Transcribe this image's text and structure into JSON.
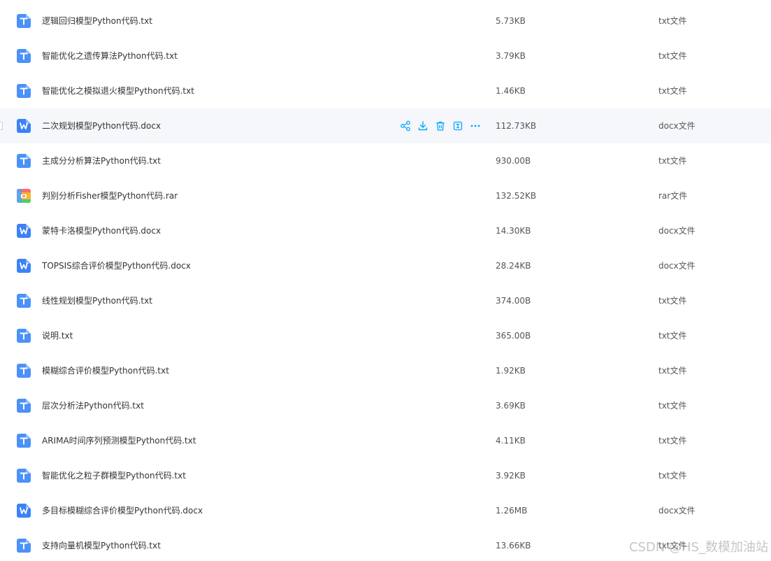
{
  "files": [
    {
      "name": "逻辑回归模型Python代码.txt",
      "size": "5.73KB",
      "type": "txt文件",
      "icon": "txt-file-icon"
    },
    {
      "name": "智能优化之遗传算法Python代码.txt",
      "size": "3.79KB",
      "type": "txt文件",
      "icon": "txt-file-icon"
    },
    {
      "name": "智能优化之模拟退火模型Python代码.txt",
      "size": "1.46KB",
      "type": "txt文件",
      "icon": "txt-file-icon"
    },
    {
      "name": "二次规划模型Python代码.docx",
      "size": "112.73KB",
      "type": "docx文件",
      "icon": "docx-file-icon"
    },
    {
      "name": "主成分分析算法Python代码.txt",
      "size": "930.00B",
      "type": "txt文件",
      "icon": "txt-file-icon"
    },
    {
      "name": "判别分析Fisher模型Python代码.rar",
      "size": "132.52KB",
      "type": "rar文件",
      "icon": "rar-file-icon"
    },
    {
      "name": "蒙特卡洛模型Python代码.docx",
      "size": "14.30KB",
      "type": "docx文件",
      "icon": "docx-file-icon"
    },
    {
      "name": "TOPSIS综合评价模型Python代码.docx",
      "size": "28.24KB",
      "type": "docx文件",
      "icon": "docx-file-icon"
    },
    {
      "name": "线性规划模型Python代码.txt",
      "size": "374.00B",
      "type": "txt文件",
      "icon": "txt-file-icon"
    },
    {
      "name": "说明.txt",
      "size": "365.00B",
      "type": "txt文件",
      "icon": "txt-file-icon"
    },
    {
      "name": "模糊综合评价模型Python代码.txt",
      "size": "1.92KB",
      "type": "txt文件",
      "icon": "txt-file-icon"
    },
    {
      "name": "层次分析法Python代码.txt",
      "size": "3.69KB",
      "type": "txt文件",
      "icon": "txt-file-icon"
    },
    {
      "name": "ARIMA时间序列预测模型Python代码.txt",
      "size": "4.11KB",
      "type": "txt文件",
      "icon": "txt-file-icon"
    },
    {
      "name": "智能优化之粒子群模型Python代码.txt",
      "size": "3.92KB",
      "type": "txt文件",
      "icon": "txt-file-icon"
    },
    {
      "name": "多目标模糊综合评价模型Python代码.docx",
      "size": "1.26MB",
      "type": "docx文件",
      "icon": "docx-file-icon"
    },
    {
      "name": "支持向量机模型Python代码.txt",
      "size": "13.66KB",
      "type": "txt文件",
      "icon": "txt-file-icon"
    }
  ],
  "hovered_row": 3,
  "hover_actions": [
    {
      "name": "share-icon"
    },
    {
      "name": "download-icon"
    },
    {
      "name": "delete-icon"
    },
    {
      "name": "rename-icon"
    },
    {
      "name": "more-icon"
    }
  ],
  "watermark": "CSDN @HS_数模加油站",
  "colors": {
    "accent": "#06a7ff",
    "txt_icon": "#4b91f7",
    "docx_icon": "#3b82f6",
    "row_hover": "#f5f7fb"
  }
}
